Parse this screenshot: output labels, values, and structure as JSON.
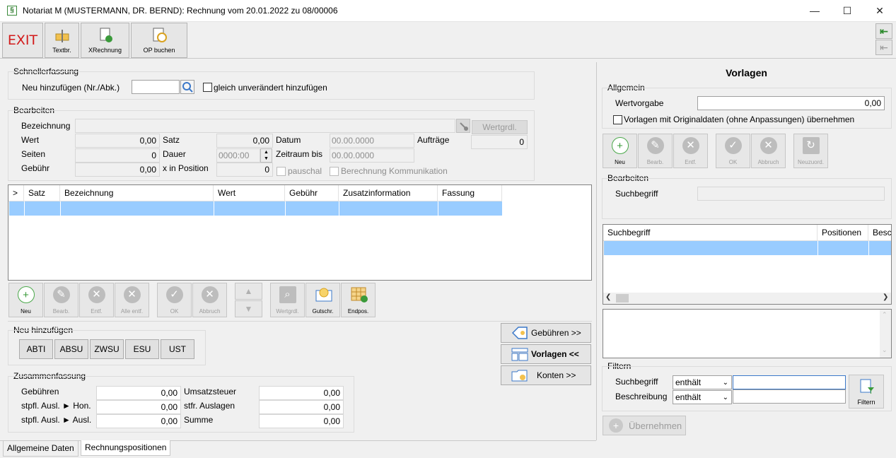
{
  "window": {
    "title": "Notariat M (MUSTERMANN, DR. BERND): Rechnung vom 20.01.2022 zu 08/00006",
    "app_icon": "§"
  },
  "toolbar": {
    "exit": "EXIT",
    "textbr": "Textbr.",
    "xrechnung": "XRechnung",
    "op_buchen": "OP buchen"
  },
  "schnell": {
    "title": "Schnellerfassung",
    "neu_label": "Neu hinzufügen (Nr./Abk.)",
    "neu_value": "",
    "gleich_label": "gleich unverändert hinzufügen"
  },
  "bearbeiten": {
    "title": "Bearbeiten",
    "bezeichnung": "Bezeichnung",
    "bezeichnung_value": "",
    "wertgrdl": "Wertgrdl.",
    "wert": "Wert",
    "wert_value": "0,00",
    "satz": "Satz",
    "satz_value": "0,00",
    "datum": "Datum",
    "datum_value": "00.00.0000",
    "auftraege": "Aufträge",
    "auftraege_value": "0",
    "seiten": "Seiten",
    "seiten_value": "0",
    "dauer": "Dauer",
    "dauer_value": "0000:00",
    "zeitraum": "Zeitraum bis",
    "zeitraum_value": "00.00.0000",
    "gebuehr": "Gebühr",
    "gebuehr_value": "0,00",
    "xinpos": "x in Position",
    "xinpos_value": "0",
    "pauschal": "pauschal",
    "berechnung": "Berechnung Kommunikation"
  },
  "grid": {
    "columns": [
      ">",
      "Satz",
      "Bezeichnung",
      "Wert",
      "Gebühr",
      "Zusatzinformation",
      "Fassung"
    ]
  },
  "actions": {
    "neu": "Neu",
    "bearb": "Bearb.",
    "entf": "Entf.",
    "alle_entf": "Alle entf.",
    "ok": "OK",
    "abbruch": "Abbruch",
    "wertgrdl": "Wertgrdl.",
    "gutschr": "Gutschr.",
    "endpos": "Endpos."
  },
  "neu_hinzu": {
    "title": "Neu hinzufügen",
    "buttons": [
      "ABTI",
      "ABSU",
      "ZWSU",
      "ESU",
      "UST"
    ]
  },
  "nav": {
    "gebuehren": "Gebühren >>",
    "vorlagen": "Vorlagen <<",
    "konten": "Konten >>"
  },
  "summary": {
    "title": "Zusammenfassung",
    "gebuehren": "Gebühren",
    "gebuehren_value": "0,00",
    "stpfl_hon": "stpfl. Ausl. ► Hon.",
    "stpfl_hon_value": "0,00",
    "stpfl_ausl": "stpfl. Ausl. ► Ausl.",
    "stpfl_ausl_value": "0,00",
    "ust": "Umsatzsteuer",
    "ust_value": "0,00",
    "stfr": "stfr. Auslagen",
    "stfr_value": "0,00",
    "summe": "Summe",
    "summe_value": "0,00"
  },
  "tabs": [
    "Allgemeine Daten",
    "Rechnungspositionen"
  ],
  "vorlagen": {
    "title": "Vorlagen",
    "allgemein": "Allgemein",
    "wertvorgabe": "Wertvorgabe",
    "wertvorgabe_value": "0,00",
    "original_label": "Vorlagen mit Originaldaten (ohne Anpassungen) übernehmen",
    "actions": {
      "neu": "Neu",
      "bearb": "Bearb.",
      "entf": "Entf.",
      "ok": "OK",
      "abbruch": "Abbruch",
      "neuzuord": "Neuzuord."
    },
    "bearbeiten": "Bearbeiten",
    "suchbegriff": "Suchbegriff",
    "suchbegriff_value": "",
    "grid_columns": [
      "Suchbegriff",
      "Positionen",
      "Besc"
    ],
    "filtern": "Filtern",
    "filter_such": "Suchbegriff",
    "filter_beschr": "Beschreibung",
    "filter_op1": "enthält",
    "filter_op2": "enthält",
    "filter_val1": "",
    "filter_val2": "",
    "filtern_btn": "Filtern",
    "uebernehmen": "Übernehmen"
  }
}
